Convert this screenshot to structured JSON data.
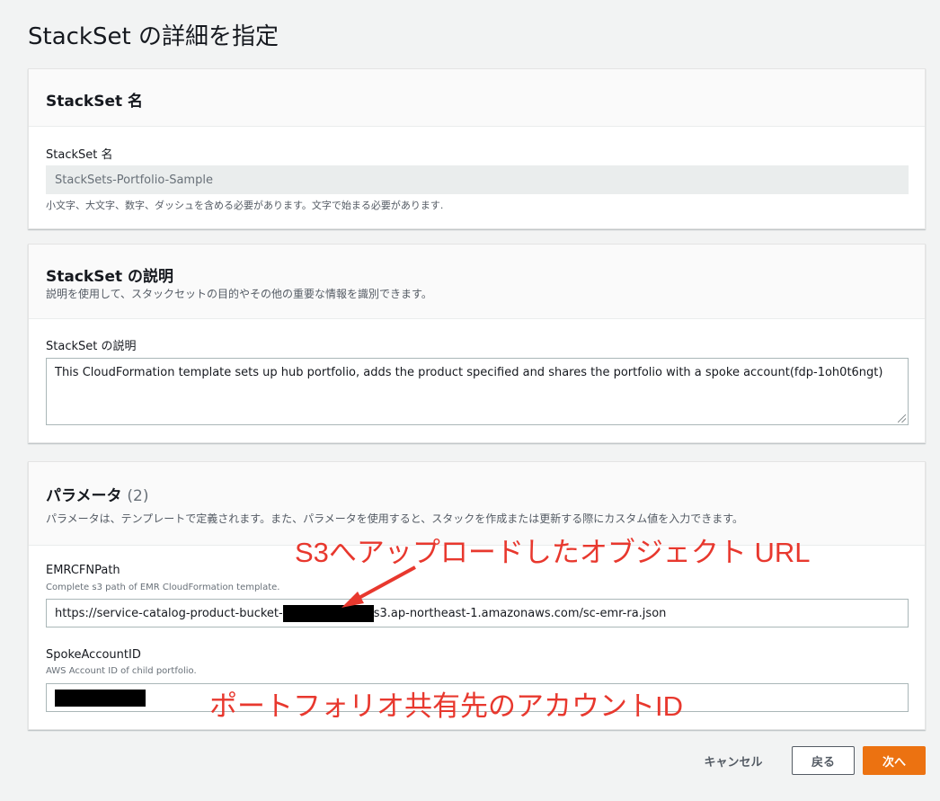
{
  "page": {
    "title": "StackSet の詳細を指定"
  },
  "name_panel": {
    "title": "StackSet 名",
    "field_label": "StackSet 名",
    "value": "StackSets-Portfolio-Sample",
    "constraint": "小文字、大文字、数字、ダッシュを含める必要があります。文字で始まる必要があります."
  },
  "description_panel": {
    "title": "StackSet の説明",
    "subtitle": "説明を使用して、スタックセットの目的やその他の重要な情報を識別できます。",
    "field_label": "StackSet の説明",
    "value": "This CloudFormation template sets up hub portfolio, adds the product specified and shares the portfolio with a spoke account(fdp-1oh0t6ngt)"
  },
  "parameters_panel": {
    "title": "パラメータ",
    "count": "(2)",
    "subtitle": "パラメータは、テンプレートで定義されます。また、パラメータを使用すると、スタックを作成または更新する際にカスタム値を入力できます。",
    "params": [
      {
        "label": "EMRCFNPath",
        "help": "Complete s3 path of EMR CloudFormation template.",
        "value_prefix": "https://service-catalog-product-bucket-",
        "value_suffix": "s3.ap-northeast-1.amazonaws.com/sc-emr-ra.json"
      },
      {
        "label": "SpokeAccountID",
        "help": "AWS Account ID of child portfolio."
      }
    ]
  },
  "annotations": {
    "s3_url": "S3へアップロードしたオブジェクト URL",
    "account_id": "ポートフォリオ共有先のアカウントID",
    "color": "#e8382e"
  },
  "footer": {
    "cancel": "キャンセル",
    "back": "戻る",
    "next": "次へ"
  },
  "colors": {
    "primary": "#ec7211",
    "background": "#f2f3f3"
  }
}
